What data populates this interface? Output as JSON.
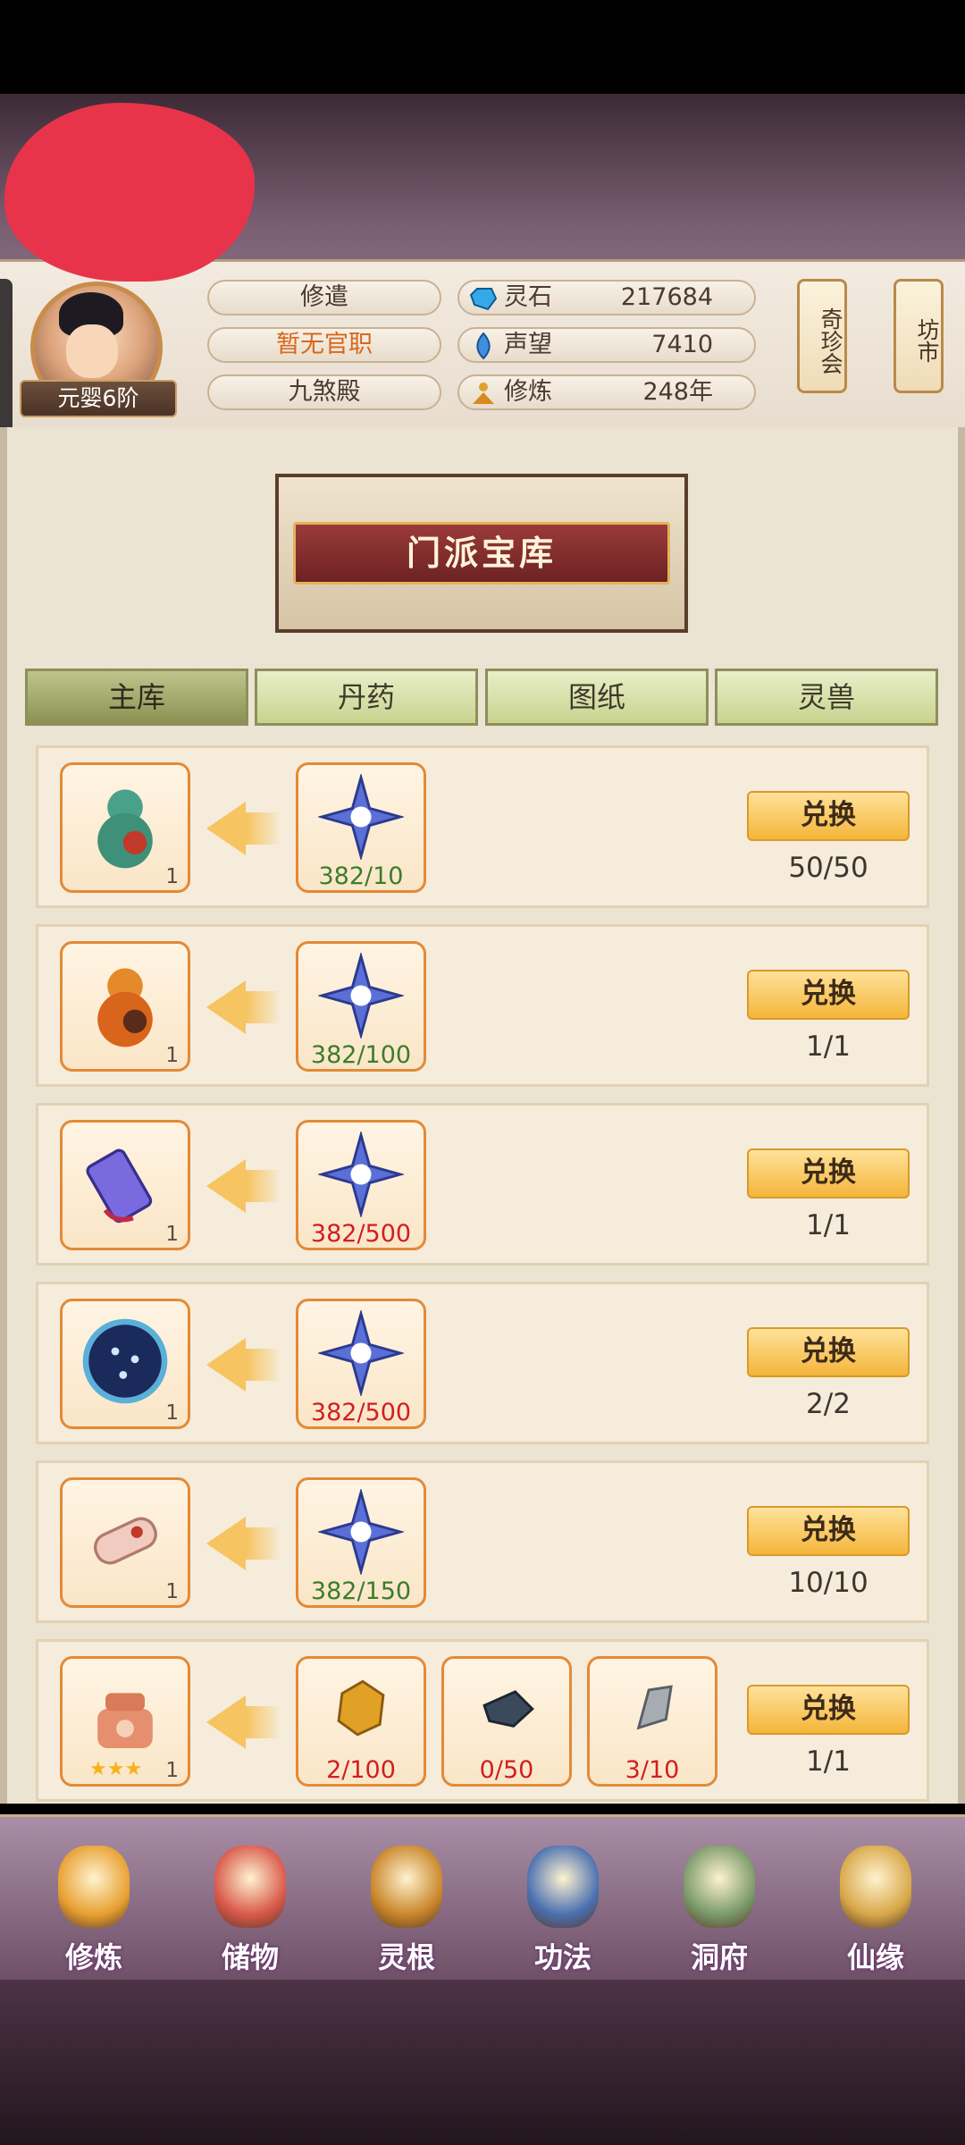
{
  "player": {
    "rank": "元婴6阶",
    "info": [
      "修遣",
      "暂无官职",
      "九煞殿"
    ]
  },
  "stats": [
    {
      "label": "灵石",
      "value": "217684",
      "icon": "spirit-stone-icon"
    },
    {
      "label": "声望",
      "value": "7410",
      "icon": "prestige-icon"
    },
    {
      "label": "修炼",
      "value": "248年",
      "icon": "cultivation-icon"
    }
  ],
  "side_buttons": [
    "奇珍会",
    "坊市"
  ],
  "banner_title": "门派宝库",
  "tabs": [
    "主库",
    "丹药",
    "图纸",
    "灵兽"
  ],
  "exchange_label": "兑换",
  "rows": [
    {
      "reward": "gourd-green-icon",
      "reward_count": "1",
      "costs": [
        {
          "icon": "spirit-star-icon",
          "text": "382/10",
          "ok": true
        }
      ],
      "limit": "50/50"
    },
    {
      "reward": "gourd-orange-icon",
      "reward_count": "1",
      "costs": [
        {
          "icon": "spirit-star-icon",
          "text": "382/100",
          "ok": true
        }
      ],
      "limit": "1/1"
    },
    {
      "reward": "sword-token-icon",
      "reward_count": "1",
      "costs": [
        {
          "icon": "spirit-star-icon",
          "text": "382/500",
          "ok": false
        }
      ],
      "limit": "1/1"
    },
    {
      "reward": "star-map-icon",
      "reward_count": "1",
      "costs": [
        {
          "icon": "spirit-star-icon",
          "text": "382/500",
          "ok": false
        }
      ],
      "limit": "2/2"
    },
    {
      "reward": "scroll-icon",
      "reward_count": "1",
      "costs": [
        {
          "icon": "spirit-star-icon",
          "text": "382/150",
          "ok": true
        }
      ],
      "limit": "10/10"
    },
    {
      "reward": "furnace-icon",
      "reward_count": "1",
      "reward_stars": "★★★",
      "costs": [
        {
          "icon": "gold-ore-icon",
          "text": "2/100",
          "ok": false
        },
        {
          "icon": "iron-ore-icon",
          "text": "0/50",
          "ok": false
        },
        {
          "icon": "silver-ore-icon",
          "text": "3/10",
          "ok": false
        }
      ],
      "limit": "1/1"
    }
  ],
  "nav": [
    "修炼",
    "储物",
    "灵根",
    "功法",
    "洞府",
    "仙缘"
  ],
  "colors": {
    "ok": "#3b7d2a",
    "insufficient": "#d01f1f",
    "accent": "#f4b53a"
  }
}
